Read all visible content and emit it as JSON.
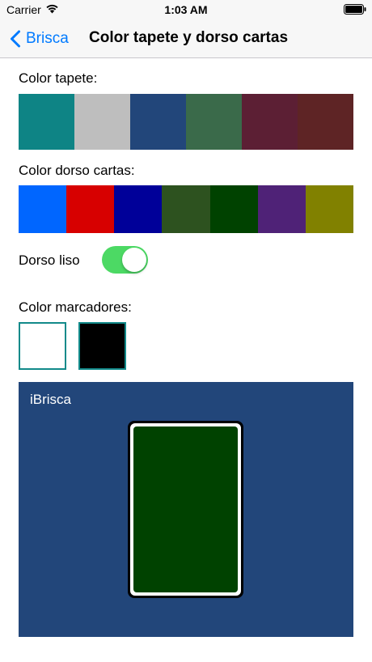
{
  "status": {
    "carrier": "Carrier",
    "time": "1:03 AM"
  },
  "nav": {
    "back_label": "Brisca",
    "title": "Color tapete y dorso cartas"
  },
  "tapete": {
    "label": "Color tapete:",
    "colors": [
      "#0e8485",
      "#bebebe",
      "#22467a",
      "#3a6a4a",
      "#5c1f34",
      "#5e2425"
    ]
  },
  "dorso": {
    "label": "Color dorso cartas:",
    "colors": [
      "#0066ff",
      "#d70000",
      "#000099",
      "#2d521f",
      "#004200",
      "#4f2277",
      "#818100"
    ]
  },
  "toggle": {
    "label": "Dorso liso",
    "on": true,
    "on_color": "#4cd964"
  },
  "marcadores": {
    "label": "Color marcadores:",
    "colors": [
      "#ffffff",
      "#000000"
    ],
    "border_color": "#128a8a"
  },
  "preview": {
    "title": "iBrisca",
    "table_color": "#22467a",
    "card_back_color": "#004200"
  }
}
